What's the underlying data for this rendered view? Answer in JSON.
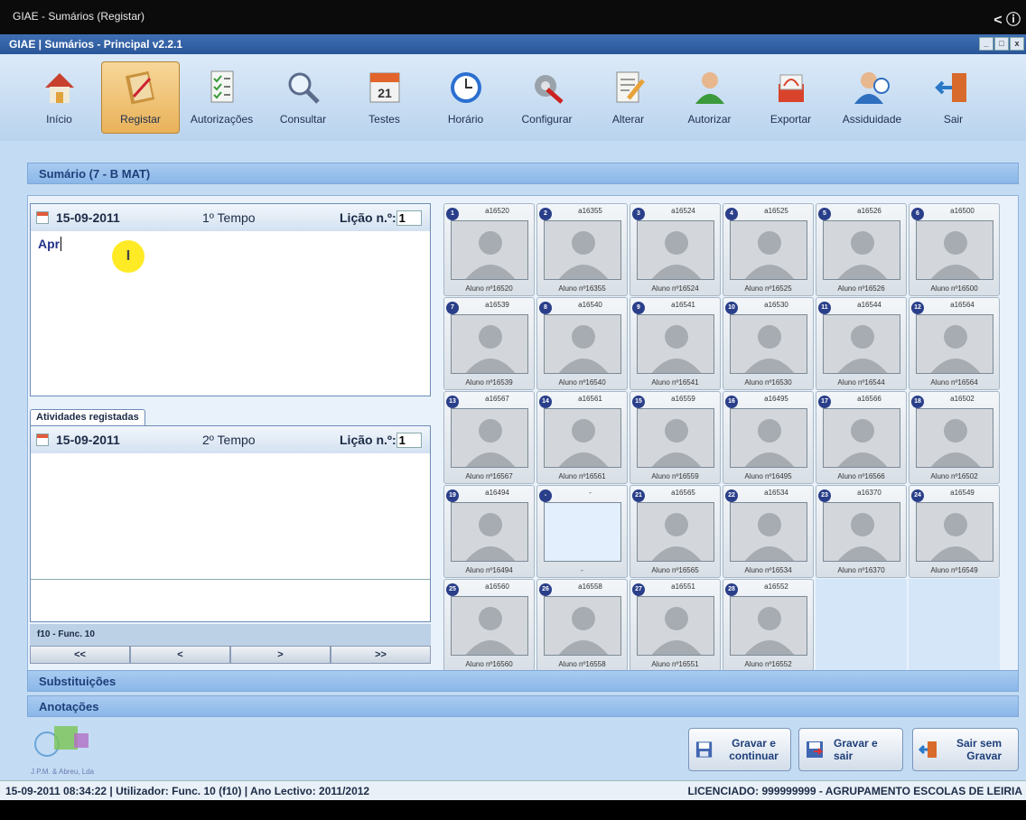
{
  "window_caption": "GIAE - Sumários (Registar)",
  "app_title": "GIAE | Sumários - Principal v2.2.1",
  "toolbar": [
    {
      "label": "Início",
      "icon": "home-icon"
    },
    {
      "label": "Registar",
      "icon": "notebook-icon",
      "active": true
    },
    {
      "label": "Autorizações",
      "icon": "checklist-icon"
    },
    {
      "label": "Consultar",
      "icon": "magnifier-icon"
    },
    {
      "label": "Testes",
      "icon": "calendar-icon"
    },
    {
      "label": "Horário",
      "icon": "clock-icon"
    },
    {
      "label": "Configurar",
      "icon": "tools-icon"
    },
    {
      "label": "Alterar",
      "icon": "edit-document-icon"
    },
    {
      "label": "Autorizar",
      "icon": "user-check-icon"
    },
    {
      "label": "Exportar",
      "icon": "pdf-export-icon"
    },
    {
      "label": "Assiduidade",
      "icon": "user-clock-icon"
    },
    {
      "label": "Sair",
      "icon": "exit-door-icon"
    }
  ],
  "calendar_icon_text": "21",
  "summary_section": "Sumário (7 - B MAT)",
  "lesson1": {
    "date": "15-09-2011",
    "tempo": "1º Tempo",
    "licao_label": "Lição n.º:",
    "licao_value": "1",
    "text": "Apr"
  },
  "activities_tab": "Atividades registadas",
  "lesson2": {
    "date": "15-09-2011",
    "tempo": "2º Tempo",
    "licao_label": "Lição n.º:",
    "licao_value": "1"
  },
  "func_label": "f10 - Func. 10",
  "nav": [
    "<<",
    "<",
    ">",
    ">>"
  ],
  "students": [
    {
      "n": "1",
      "id": "a16520",
      "label": "Aluno nº16520"
    },
    {
      "n": "2",
      "id": "a16355",
      "label": "Aluno nº16355"
    },
    {
      "n": "3",
      "id": "a16524",
      "label": "Aluno nº16524"
    },
    {
      "n": "4",
      "id": "a16525",
      "label": "Aluno nº16525"
    },
    {
      "n": "5",
      "id": "a16526",
      "label": "Aluno nº16526"
    },
    {
      "n": "6",
      "id": "a16500",
      "label": "Aluno nº16500"
    },
    {
      "n": "7",
      "id": "a16539",
      "label": "Aluno nº16539"
    },
    {
      "n": "8",
      "id": "a16540",
      "label": "Aluno nº16540"
    },
    {
      "n": "9",
      "id": "a16541",
      "label": "Aluno nº16541"
    },
    {
      "n": "10",
      "id": "a16530",
      "label": "Aluno nº16530"
    },
    {
      "n": "11",
      "id": "a16544",
      "label": "Aluno nº16544"
    },
    {
      "n": "12",
      "id": "a16564",
      "label": "Aluno nº16564"
    },
    {
      "n": "13",
      "id": "a16567",
      "label": "Aluno nº16567"
    },
    {
      "n": "14",
      "id": "a16561",
      "label": "Aluno nº16561"
    },
    {
      "n": "15",
      "id": "a16559",
      "label": "Aluno nº16559"
    },
    {
      "n": "16",
      "id": "a16495",
      "label": "Aluno nº16495"
    },
    {
      "n": "17",
      "id": "a16566",
      "label": "Aluno nº16566"
    },
    {
      "n": "18",
      "id": "a16502",
      "label": "Aluno nº16502"
    },
    {
      "n": "19",
      "id": "a16494",
      "label": "Aluno nº16494"
    },
    {
      "n": "-",
      "id": "-",
      "label": "-",
      "empty": true
    },
    {
      "n": "21",
      "id": "a16565",
      "label": "Aluno nº16565"
    },
    {
      "n": "22",
      "id": "a16534",
      "label": "Aluno nº16534"
    },
    {
      "n": "23",
      "id": "a16370",
      "label": "Aluno nº16370"
    },
    {
      "n": "24",
      "id": "a16549",
      "label": "Aluno nº16549"
    },
    {
      "n": "25",
      "id": "a16560",
      "label": "Aluno nº16560"
    },
    {
      "n": "26",
      "id": "a16558",
      "label": "Aluno nº16558"
    },
    {
      "n": "27",
      "id": "a16551",
      "label": "Aluno nº16551"
    },
    {
      "n": "28",
      "id": "a16552",
      "label": "Aluno nº16552"
    }
  ],
  "sections": {
    "substituicoes": "Substituições",
    "anotacoes": "Anotações"
  },
  "logo_text": "J.P.M. & Abreu, Lda",
  "buttons": {
    "gravar_continuar": "Gravar e continuar",
    "gravar_sair": "Gravar e sair",
    "sair_sem_gravar": "Sair sem Gravar"
  },
  "status": {
    "left": "15-09-2011 08:34:22 | Utilizador: Func. 10 (f10) | Ano Lectivo: 2011/2012",
    "right": "LICENCIADO: 999999999 - AGRUPAMENTO ESCOLAS DE LEIRIA"
  },
  "colors": {
    "accent": "#2a5699",
    "active_tab": "#e9b259",
    "panel": "#c4dcf3"
  }
}
